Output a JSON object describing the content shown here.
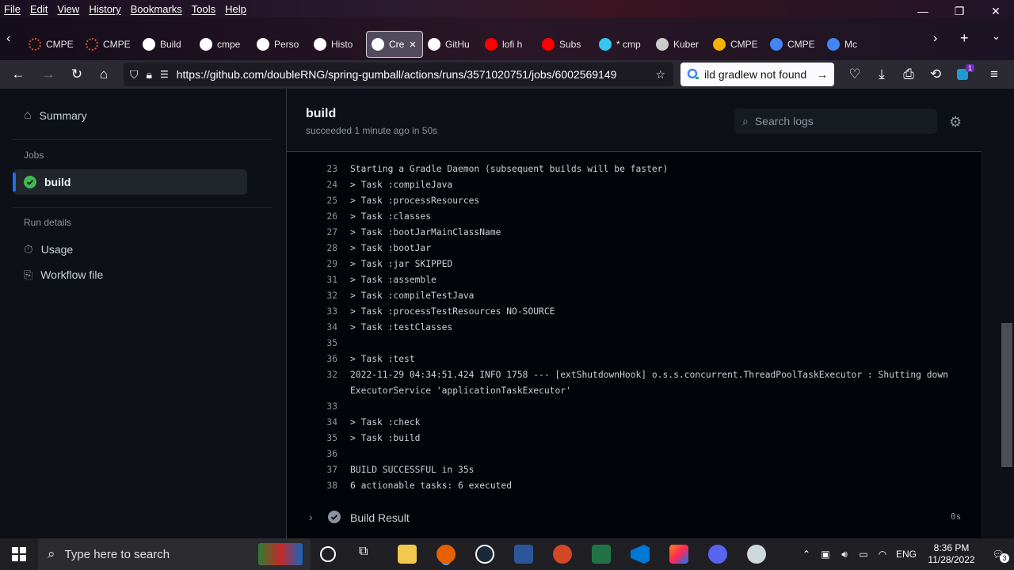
{
  "menu": [
    "File",
    "Edit",
    "View",
    "History",
    "Bookmarks",
    "Tools",
    "Help"
  ],
  "tabs": [
    {
      "label": "CMPE",
      "icon": "cmpe-icon",
      "color": "#e24b2b"
    },
    {
      "label": "CMPE",
      "icon": "cmpe-icon",
      "color": "#e24b2b"
    },
    {
      "label": "Build",
      "icon": "github-icon",
      "color": "#ffffff"
    },
    {
      "label": "cmpe",
      "icon": "github-icon",
      "color": "#ffffff"
    },
    {
      "label": "Perso",
      "icon": "github-icon",
      "color": "#ffffff"
    },
    {
      "label": "Histo",
      "icon": "github-icon",
      "color": "#ffffff"
    },
    {
      "label": "Cre",
      "icon": "github-icon",
      "color": "#ffffff",
      "active": true
    },
    {
      "label": "GitHu",
      "icon": "github-icon",
      "color": "#ffffff"
    },
    {
      "label": "lofi h",
      "icon": "youtube-icon",
      "color": "#ff0000"
    },
    {
      "label": "Subs",
      "icon": "youtube-icon",
      "color": "#ff0000"
    },
    {
      "label": "* cmp",
      "icon": "slack-icon",
      "color": "#36c5f0"
    },
    {
      "label": "Kuber",
      "icon": "kubernetes-icon",
      "color": "#cccccc"
    },
    {
      "label": "CMPE",
      "icon": "drive-icon",
      "color": "#f4b400"
    },
    {
      "label": "CMPE",
      "icon": "docs-icon",
      "color": "#4285f4"
    },
    {
      "label": "Mc",
      "icon": "docs-icon",
      "color": "#4285f4"
    }
  ],
  "url": "https://github.com/doubleRNG/spring-gumball/actions/runs/3571020751/jobs/6002569149",
  "search_text": "ild gradlew not found",
  "badge_count": "1",
  "sidebar": {
    "summary": "Summary",
    "jobs_heading": "Jobs",
    "job_build": "build",
    "run_details_heading": "Run details",
    "usage": "Usage",
    "workflow_file": "Workflow file"
  },
  "header": {
    "title": "build",
    "subtitle": "succeeded 1 minute ago in 50s",
    "search_placeholder": "Search logs"
  },
  "log_lines": [
    {
      "n": "23",
      "t": "Starting a Gradle Daemon (subsequent builds will be faster)"
    },
    {
      "n": "24",
      "t": "> Task :compileJava"
    },
    {
      "n": "25",
      "t": "> Task :processResources"
    },
    {
      "n": "26",
      "t": "> Task :classes"
    },
    {
      "n": "27",
      "t": "> Task :bootJarMainClassName"
    },
    {
      "n": "28",
      "t": "> Task :bootJar"
    },
    {
      "n": "29",
      "t": "> Task :jar SKIPPED"
    },
    {
      "n": "31",
      "t": "> Task :assemble"
    },
    {
      "n": "32",
      "t": "> Task :compileTestJava"
    },
    {
      "n": "33",
      "t": "> Task :processTestResources NO-SOURCE"
    },
    {
      "n": "34",
      "t": "> Task :testClasses"
    },
    {
      "n": "35",
      "t": ""
    },
    {
      "n": "36",
      "t": "> Task :test"
    },
    {
      "n": "32",
      "t": "2022-11-29 04:34:51.424  INFO 1758 --- [extShutdownHook] o.s.s.concurrent.ThreadPoolTaskExecutor  : Shutting down ExecutorService 'applicationTaskExecutor'",
      "wrap": true
    },
    {
      "n": "33",
      "t": ""
    },
    {
      "n": "34",
      "t": "> Task :check"
    },
    {
      "n": "35",
      "t": "> Task :build"
    },
    {
      "n": "36",
      "t": ""
    },
    {
      "n": "37",
      "t": "BUILD SUCCESSFUL in 35s"
    },
    {
      "n": "38",
      "t": "6 actionable tasks: 6 executed"
    }
  ],
  "step": {
    "label": "Build Result",
    "duration": "0s"
  },
  "taskbar": {
    "search_placeholder": "Type here to search",
    "time": "8:36 PM",
    "date": "11/28/2022",
    "language": "ENG",
    "notification_count": "3"
  }
}
